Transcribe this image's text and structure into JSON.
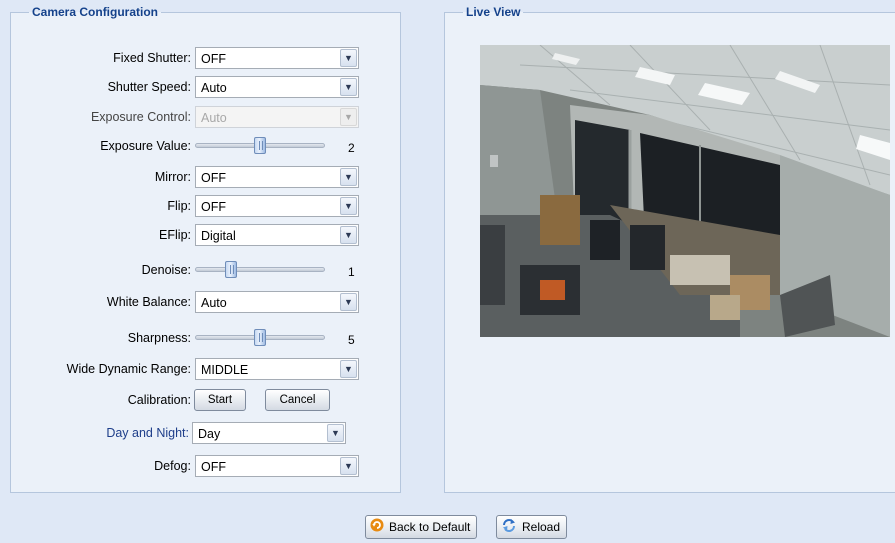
{
  "camera_config": {
    "title": "Camera Configuration",
    "fields": {
      "fixed_shutter": {
        "label": "Fixed Shutter:",
        "value": "OFF"
      },
      "shutter_speed": {
        "label": "Shutter Speed:",
        "value": "Auto"
      },
      "exposure_control": {
        "label": "Exposure Control:",
        "value": "Auto",
        "disabled": true
      },
      "exposure_value": {
        "label": "Exposure Value:",
        "value": "2",
        "level_fraction": 0.5
      },
      "mirror": {
        "label": "Mirror:",
        "value": "OFF"
      },
      "flip": {
        "label": "Flip:",
        "value": "OFF"
      },
      "eflip": {
        "label": "EFlip:",
        "value": "Digital"
      },
      "denoise": {
        "label": "Denoise:",
        "value": "1",
        "level_fraction": 0.25
      },
      "white_balance": {
        "label": "White Balance:",
        "value": "Auto"
      },
      "sharpness": {
        "label": "Sharpness:",
        "value": "5",
        "level_fraction": 0.5
      },
      "wide_dynamic_range": {
        "label": "Wide Dynamic Range:",
        "value": "MIDDLE"
      },
      "calibration": {
        "label": "Calibration:",
        "start_label": "Start",
        "cancel_label": "Cancel"
      },
      "day_and_night": {
        "label": "Day and Night:",
        "value": "Day"
      },
      "defog": {
        "label": "Defog:",
        "value": "OFF"
      }
    }
  },
  "live_view": {
    "title": "Live View",
    "image_description_icon": "camera-feed-office"
  },
  "footer": {
    "back_to_default_label": "Back to Default",
    "back_to_default_icon": "undo-arrow-icon",
    "reload_label": "Reload",
    "reload_icon": "refresh-icon"
  },
  "colors": {
    "background": "#dfe8f6",
    "panel": "#ebf1f9",
    "legend_text": "#15428b",
    "accent_label": "#1e3e8a"
  }
}
